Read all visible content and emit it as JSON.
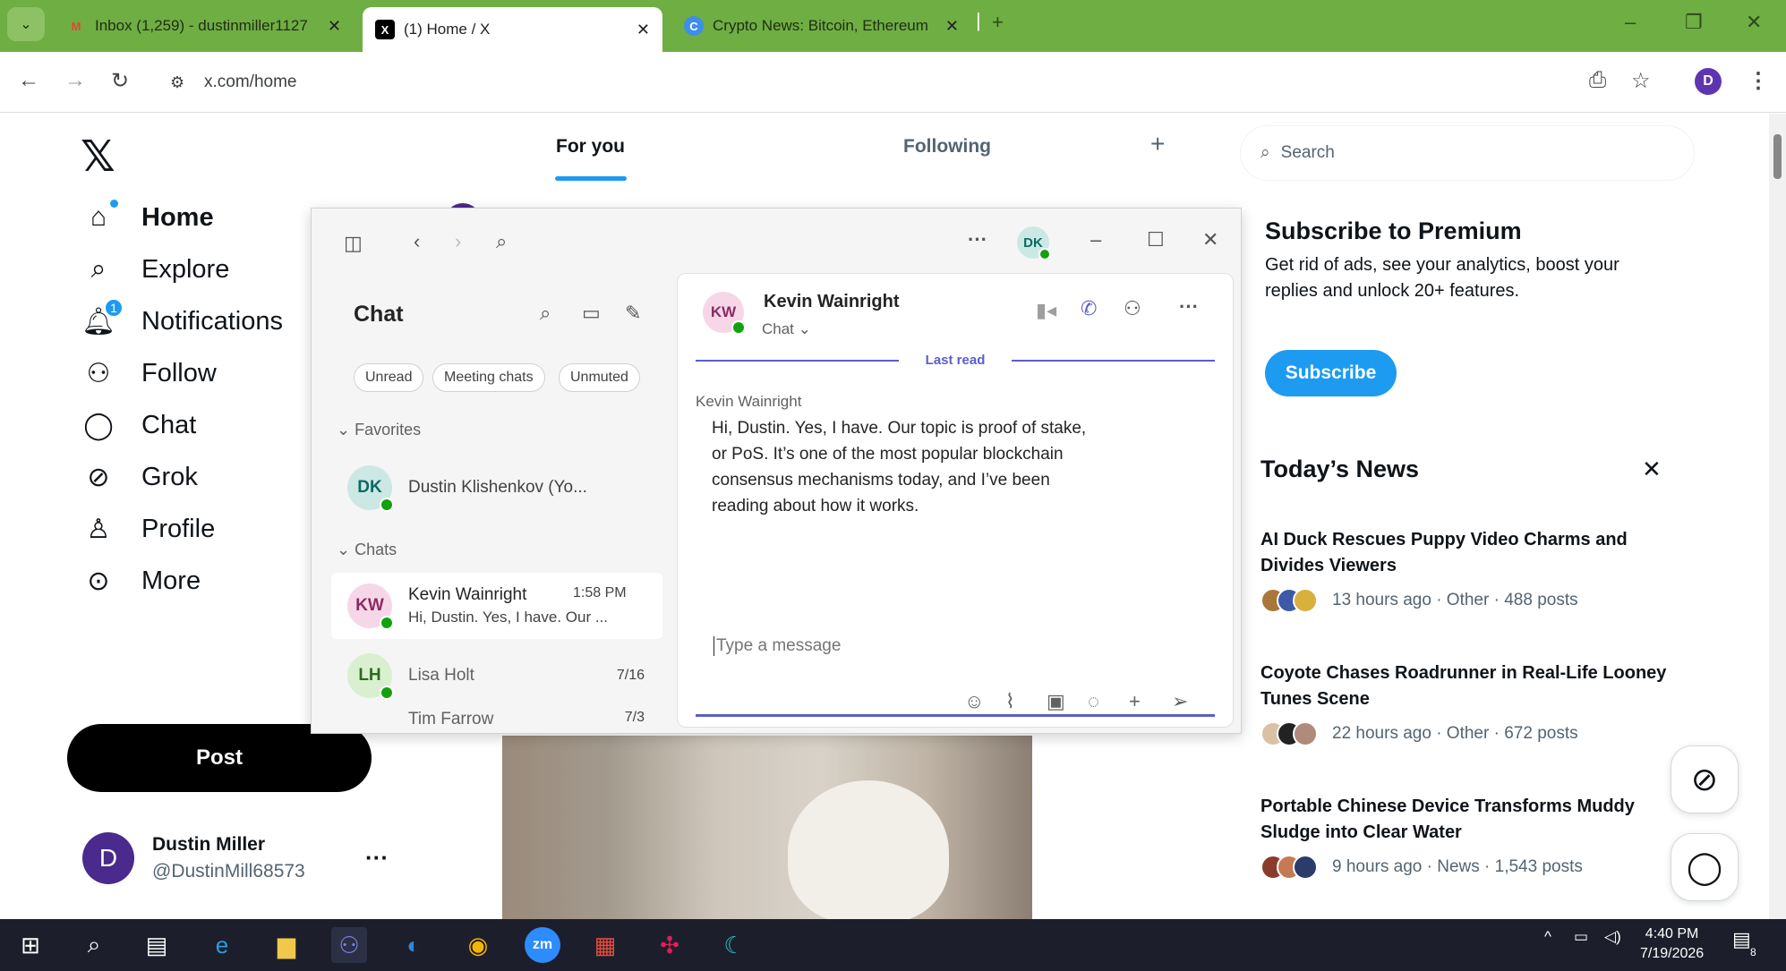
{
  "browser": {
    "tabs": [
      {
        "title": "Inbox (1,259) - dustinmiller1127",
        "active": false
      },
      {
        "title": "(1) Home / X",
        "active": true
      },
      {
        "title": "Crypto News: Bitcoin, Ethereum",
        "active": false
      }
    ],
    "url": "x.com/home",
    "profile_initial": "D"
  },
  "x": {
    "nav": [
      {
        "label": "Home",
        "icon": "home-icon"
      },
      {
        "label": "Explore",
        "icon": "search-icon"
      },
      {
        "label": "Notifications",
        "icon": "bell-icon",
        "badge": "1"
      },
      {
        "label": "Follow",
        "icon": "person-add-icon"
      },
      {
        "label": "Chat",
        "icon": "chat-bubble-icon"
      },
      {
        "label": "Grok",
        "icon": "grok-icon"
      },
      {
        "label": "Profile",
        "icon": "person-icon"
      },
      {
        "label": "More",
        "icon": "more-circle-icon"
      }
    ],
    "post_label": "Post",
    "account": {
      "initial": "D",
      "name": "Dustin Miller",
      "handle": "@DustinMill68573",
      "more": "···"
    },
    "feed_tabs": [
      "For you",
      "Following"
    ],
    "search_placeholder": "Search",
    "premium": {
      "title": "Subscribe to Premium",
      "text": "Get rid of ads, see your analytics, boost your replies and unlock 20+ features.",
      "button": "Subscribe"
    },
    "news_title": "Today’s News",
    "news": [
      {
        "title": "AI Duck Rescues Puppy Video Charms and Divides Viewers",
        "meta": "13 hours ago · Other · 488 posts"
      },
      {
        "title": "Coyote Chases Roadrunner in Real-Life Looney Tunes Scene",
        "meta": "22 hours ago · Other · 672 posts"
      },
      {
        "title": "Portable Chinese Device Transforms Muddy Sludge into Clear Water",
        "meta": "9 hours ago · News · 1,543 posts"
      }
    ]
  },
  "teams": {
    "user_initials": "DK",
    "chat_title": "Chat",
    "filters": [
      "Unread",
      "Meeting chats",
      "Unmuted"
    ],
    "favorites_label": "Favorites",
    "chats_label": "Chats",
    "favorites": [
      {
        "initials": "DK",
        "name": "Dustin Klishenkov (Yo..."
      }
    ],
    "chats": [
      {
        "initials": "KW",
        "name": "Kevin Wainright",
        "preview": "Hi, Dustin. Yes, I have. Our ...",
        "time": "1:58 PM"
      },
      {
        "initials": "LH",
        "name": "Lisa Holt",
        "preview": "",
        "time": "7/16"
      },
      {
        "initials": "",
        "name": "Tim Farrow",
        "preview": "",
        "time": "7/3"
      }
    ],
    "conversation": {
      "initials": "KW",
      "name": "Kevin Wainright",
      "sub": "Chat",
      "last_read": "Last read",
      "sender": "Kevin Wainright",
      "message": "Hi, Dustin. Yes, I have. Our topic is proof of stake, or PoS. It’s one of the most popular blockchain consensus mechanisms today, and I’ve been reading about how it works.",
      "placeholder": "Type a message"
    }
  },
  "taskbar": {
    "time": "4:40 PM",
    "date": "7/19/2026",
    "notif_count": "8"
  }
}
